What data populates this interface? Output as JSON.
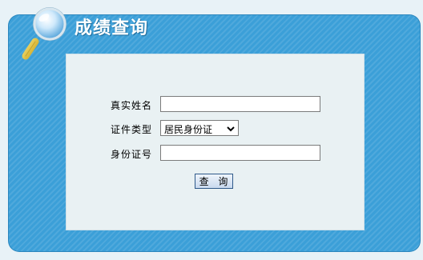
{
  "header": {
    "title": "成绩查询",
    "icon": "magnifier-icon"
  },
  "form": {
    "name_label": "真实姓名",
    "name_value": "",
    "cert_type_label": "证件类型",
    "cert_type_selected": "居民身份证",
    "id_label": "身份证号",
    "id_value": "",
    "submit_label": "查 询"
  },
  "colors": {
    "panel_blue": "#3b9fd8",
    "form_background": "#e9f1f3"
  }
}
